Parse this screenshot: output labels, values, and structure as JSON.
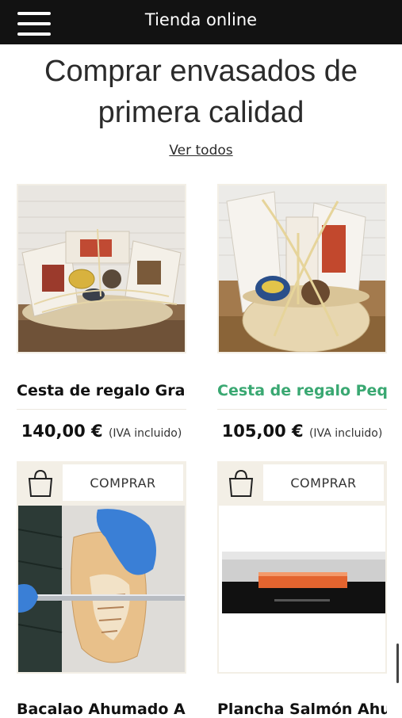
{
  "header": {
    "menu_icon": "hamburger-menu-icon",
    "title": "Tienda online"
  },
  "section": {
    "heading": "Comprar envasados de primera calidad",
    "view_all": "Ver todos"
  },
  "products": [
    {
      "title": "Cesta de regalo Gran",
      "price": "140,00 €",
      "tax_note": "(IVA incluido)",
      "title_color": "#111111"
    },
    {
      "title": "Cesta de regalo Pequ",
      "price": "105,00 €",
      "tax_note": "(IVA incluido)",
      "title_color": "#3aa872"
    },
    {
      "title": "Bacalao Ahumado Ar",
      "buy_label": "COMPRAR",
      "bag_icon": "shopping-bag-icon"
    },
    {
      "title": "Plancha Salmón Ahu",
      "buy_label": "COMPRAR",
      "bag_icon": "shopping-bag-icon"
    }
  ]
}
